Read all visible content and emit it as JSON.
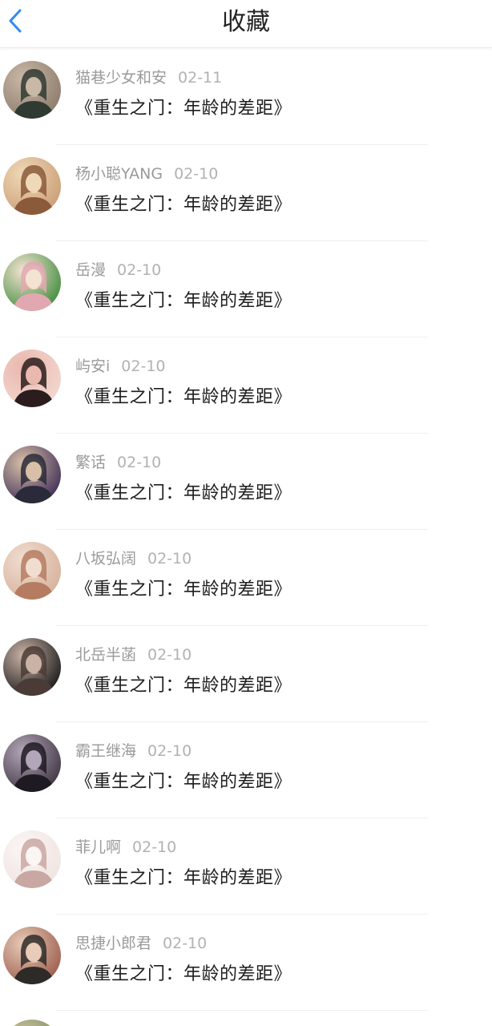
{
  "header": {
    "title": "收藏"
  },
  "items": [
    {
      "name": "猫巷少女和安",
      "date": "02-11",
      "book": "《重生之门：年龄的差距》",
      "avatar_colors": [
        "#8b7a6a",
        "#2f3a33",
        "#c9b8a6"
      ]
    },
    {
      "name": "杨小聪YANG",
      "date": "02-10",
      "book": "《重生之门：年龄的差距》",
      "avatar_colors": [
        "#c99c74",
        "#8a5a3a",
        "#f0d9b8"
      ]
    },
    {
      "name": "岳漫",
      "date": "02-10",
      "book": "《重生之门：年龄的差距》",
      "avatar_colors": [
        "#3e8a3a",
        "#e2a8b2",
        "#f4e3d2"
      ]
    },
    {
      "name": "屿安i",
      "date": "02-10",
      "book": "《重生之门：年龄的差距》",
      "avatar_colors": [
        "#f3d8cf",
        "#2b1d1d",
        "#e9b8ae"
      ]
    },
    {
      "name": "繁话",
      "date": "02-10",
      "book": "《重生之门：年龄的差距》",
      "avatar_colors": [
        "#3c2b55",
        "#2a2a3a",
        "#d8c0a8"
      ]
    },
    {
      "name": "八坂弘阔",
      "date": "02-10",
      "book": "《重生之门：年龄的差距》",
      "avatar_colors": [
        "#d6b09a",
        "#b57c62",
        "#f1ddd0"
      ]
    },
    {
      "name": "北岳半菡",
      "date": "02-10",
      "book": "《重生之门：年龄的差距》",
      "avatar_colors": [
        "#161616",
        "#4b3b36",
        "#c9b3a6"
      ]
    },
    {
      "name": "霸王继海",
      "date": "02-10",
      "book": "《重生之门：年龄的差距》",
      "avatar_colors": [
        "#3d3340",
        "#1e1a22",
        "#b3a6b8"
      ]
    },
    {
      "name": "菲儿啊",
      "date": "02-10",
      "book": "《重生之门：年龄的差距》",
      "avatar_colors": [
        "#efe4e2",
        "#c9a7a3",
        "#fbf5f3"
      ]
    },
    {
      "name": "思捷小郎君",
      "date": "02-10",
      "book": "《重生之门：年龄的差距》",
      "avatar_colors": [
        "#9a5a4a",
        "#2e2a28",
        "#e8cbb8"
      ]
    }
  ],
  "partial_item": {
    "avatar_colors": [
      "#7a8a5a",
      "#4a5a3a",
      "#c8c0a0"
    ]
  },
  "colors": {
    "back_arrow": "#2f8df0",
    "title": "#222222",
    "name": "#9a9a9a",
    "book": "#1e1e1e"
  }
}
